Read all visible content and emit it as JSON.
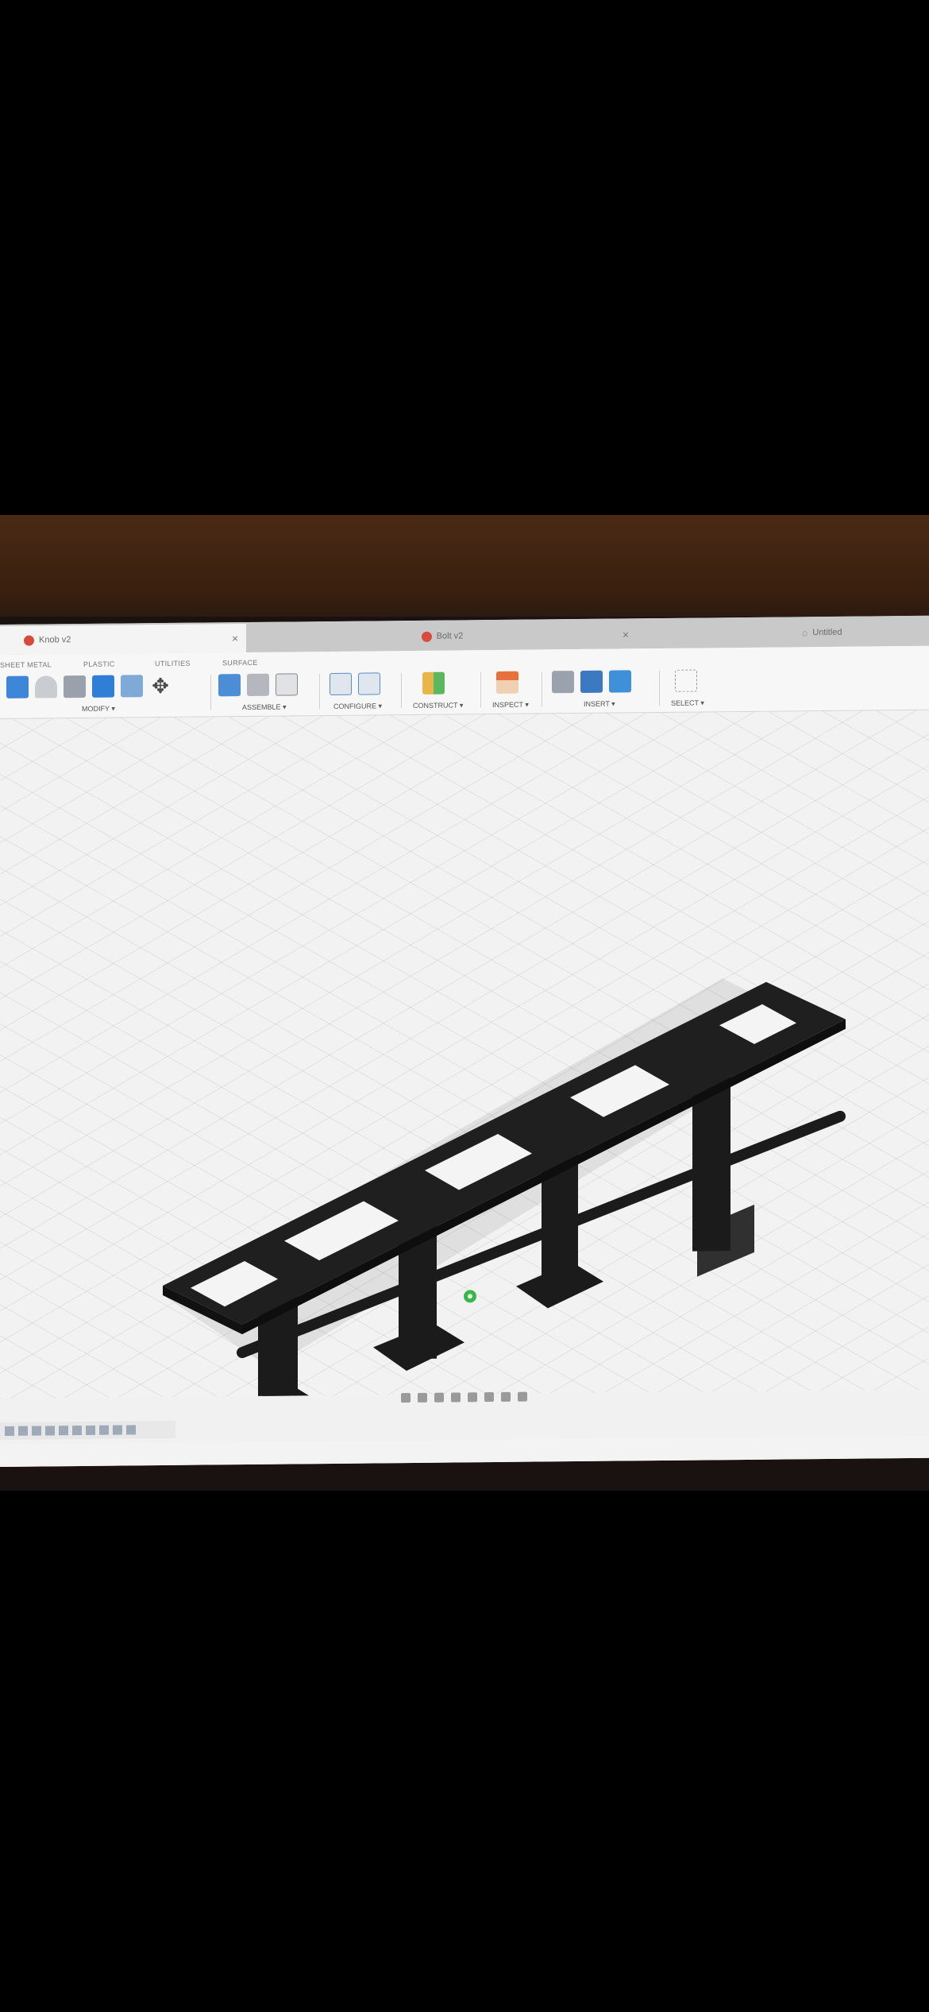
{
  "tabs": [
    {
      "label": "Knob v2",
      "active": true
    },
    {
      "label": "Bolt v2",
      "active": false
    },
    {
      "label": "Untitled",
      "active": false
    }
  ],
  "ribbon_tabs": [
    "SHEET METAL",
    "PLASTIC",
    "UTILITIES",
    "SURFACE"
  ],
  "groups": {
    "modify": "MODIFY ▾",
    "assemble": "ASSEMBLE ▾",
    "configure": "CONFIGURE ▾",
    "construct": "CONSTRUCT ▾",
    "inspect": "INSPECT ▾",
    "insert": "INSERT ▾",
    "select": "SELECT ▾"
  },
  "colors": {
    "model": "#1b1b1b",
    "accent_blue": "#2f7fd6",
    "grid_bg": "#f2f2f2",
    "origin_point": "#39b54a"
  },
  "icons": [
    "sketch-icon",
    "extrude-icon",
    "revolve-icon",
    "box-icon",
    "shell-icon",
    "move-icon",
    "joint-icon",
    "rigid-group-icon",
    "table-icon",
    "configure-icon",
    "plane-icon",
    "measure-icon",
    "insert-mesh-icon",
    "decal-icon",
    "select-icon"
  ]
}
